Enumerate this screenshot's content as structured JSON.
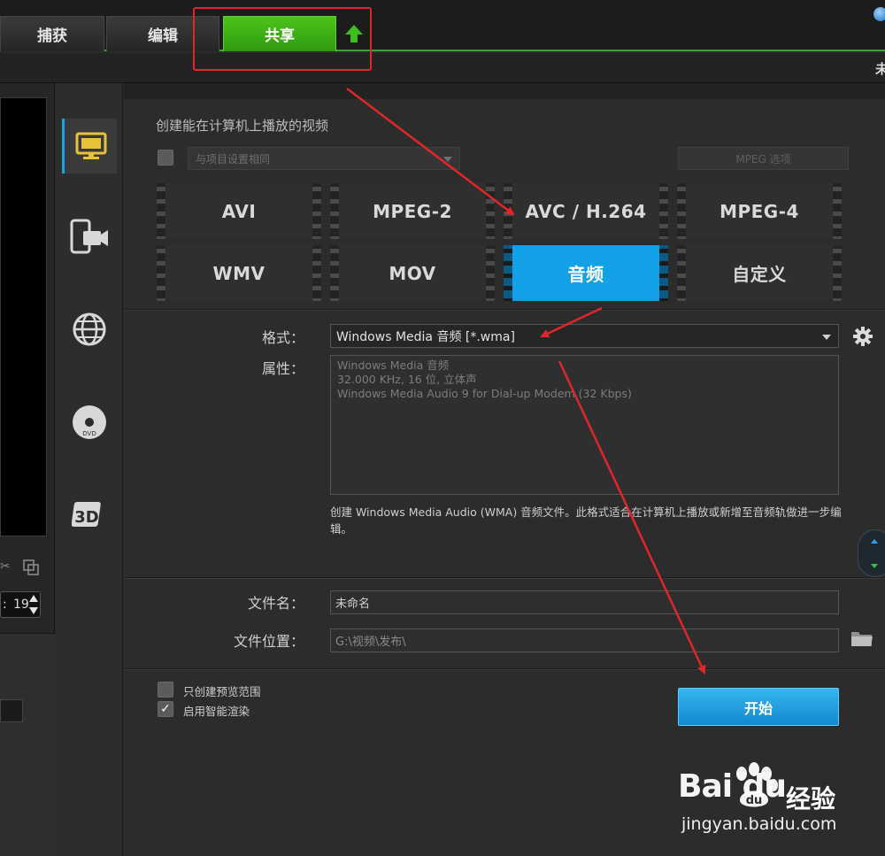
{
  "tabs": [
    {
      "label": "捕获"
    },
    {
      "label": "编辑"
    },
    {
      "label": "共享"
    }
  ],
  "header": {
    "unsaved_char": "未"
  },
  "preview": {
    "timecode": "19"
  },
  "share": {
    "section_title": "创建能在计算机上播放的视频",
    "same_as_project_label": "与项目设置相同",
    "mpeg_settings_label": "MPEG 选项",
    "formats": [
      {
        "label": "AVI",
        "active": false
      },
      {
        "label": "MPEG-2",
        "active": false
      },
      {
        "label": "AVC / H.264",
        "active": false
      },
      {
        "label": "MPEG-4",
        "active": false
      },
      {
        "label": "WMV",
        "active": false
      },
      {
        "label": "MOV",
        "active": false
      },
      {
        "label": "音频",
        "active": true
      },
      {
        "label": "自定义",
        "active": false
      }
    ],
    "format_label": "格式：",
    "format_value": "Windows Media 音频 [*.wma]",
    "properties_label": "属性：",
    "properties_lines": [
      "Windows Media 音频",
      "32.000 KHz, 16 位, 立体声",
      "Windows Media Audio 9 for Dial-up Modem (32 Kbps)"
    ],
    "description": "创建 Windows Media Audio (WMA) 音频文件。此格式适合在计算机上播放或新增至音频轨做进一步编辑。",
    "filename_label": "文件名：",
    "filename_value": "未命名",
    "location_label": "文件位置：",
    "location_value": "G:\\视频\\发布\\",
    "option_preview_range": "只创建预览范围",
    "option_smart_render": "启用智能渲染",
    "start_button": "开始"
  },
  "watermark": {
    "brand": "Bai   du",
    "brand_suffix": "经验",
    "url": "jingyan.baidu.com"
  },
  "colors": {
    "accent_green": "#3aa63a",
    "accent_blue": "#12a0e6",
    "annotation_red": "#e0262b"
  }
}
